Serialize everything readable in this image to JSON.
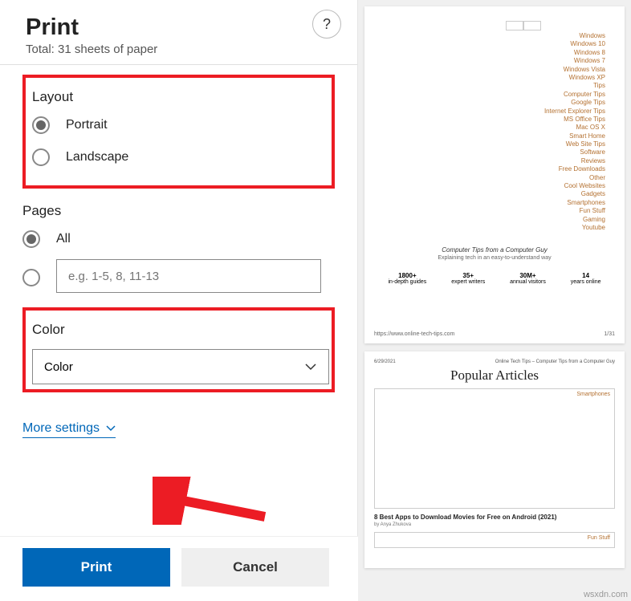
{
  "header": {
    "title": "Print",
    "subtitle": "Total: 31 sheets of paper",
    "help_label": "?"
  },
  "layout": {
    "section_label": "Layout",
    "portrait_label": "Portrait",
    "landscape_label": "Landscape",
    "selected": "portrait"
  },
  "pages": {
    "section_label": "Pages",
    "all_label": "All",
    "placeholder": "e.g. 1-5, 8, 11-13",
    "selected": "all"
  },
  "color": {
    "section_label": "Color",
    "selected_label": "Color"
  },
  "more_settings_label": "More settings",
  "footer": {
    "print_label": "Print",
    "cancel_label": "Cancel"
  },
  "preview": {
    "page1": {
      "links": [
        "Windows",
        "Windows 10",
        "Windows 8",
        "Windows 7",
        "Windows Vista",
        "Windows XP",
        "Tips",
        "Computer Tips",
        "Google Tips",
        "Internet Explorer Tips",
        "MS Office Tips",
        "Mac OS X",
        "Smart Home",
        "Web Site Tips",
        "Software",
        "Reviews",
        "Free Downloads",
        "Other",
        "Cool Websites",
        "Gadgets",
        "Smartphones",
        "Fun Stuff",
        "Gaming",
        "Youtube"
      ],
      "tagline": "Computer Tips from a Computer Guy",
      "subtag": "Explaining tech in an easy-to-understand way",
      "stats": [
        {
          "num": "1800+",
          "lbl": "in-depth guides"
        },
        {
          "num": "35+",
          "lbl": "expert writers"
        },
        {
          "num": "30M+",
          "lbl": "annual visitors"
        },
        {
          "num": "14",
          "lbl": "years online"
        }
      ],
      "url": "https://www.online-tech-tips.com",
      "page_num": "1/31"
    },
    "page2": {
      "date": "6/29/2021",
      "hdr_right": "Online Tech Tips – Computer Tips from a Computer Guy",
      "title": "Popular Articles",
      "tag1": "Smartphones",
      "article": "8 Best Apps to Download Movies for Free on Android (2021)",
      "author": "by Anya Zhukova",
      "tag2": "Fun Stuff"
    }
  },
  "watermark": "wsxdn.com"
}
